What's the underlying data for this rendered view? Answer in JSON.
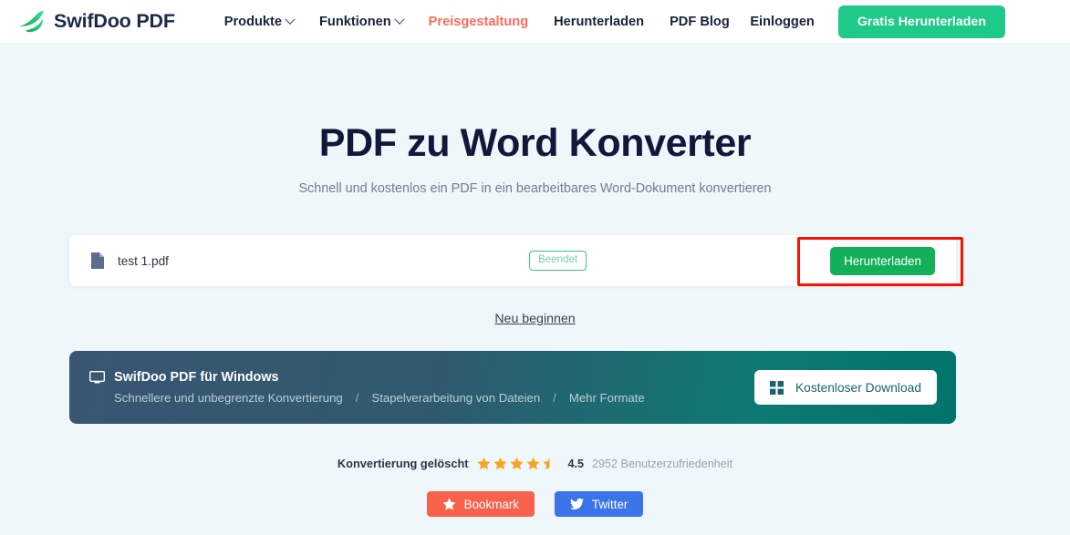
{
  "header": {
    "logo_icon": "swift-bird-logo-icon",
    "logo_text": "SwifDoo PDF",
    "nav": [
      {
        "label": "Produkte",
        "has_dropdown": true,
        "accent": false
      },
      {
        "label": "Funktionen",
        "has_dropdown": true,
        "accent": false
      },
      {
        "label": "Preisgestaltung",
        "has_dropdown": false,
        "accent": true
      },
      {
        "label": "Herunterladen",
        "has_dropdown": false,
        "accent": false
      },
      {
        "label": "PDF Blog",
        "has_dropdown": false,
        "accent": false
      }
    ],
    "login_label": "Einloggen",
    "cta_label": "Gratis Herunterladen",
    "cta_color": "#1ec98a",
    "accent_color": "#ff6b5b"
  },
  "hero": {
    "title": "PDF zu Word Konverter",
    "subtitle": "Schnell und kostenlos ein PDF in ein bearbeitbares Word-Dokument konvertieren"
  },
  "file_card": {
    "file_icon": "document-file-icon",
    "file_name": "test 1.pdf",
    "status_badge": "Beendet",
    "status_color": "#3cc87f",
    "download_label": "Herunterladen",
    "download_color": "#12b058",
    "highlight_color": "#fb1100"
  },
  "restart_link": "Neu beginnen",
  "promo": {
    "monitor_icon": "monitor-icon",
    "title": "SwifDoo PDF für Windows",
    "features": [
      "Schnellere und unbegrenzte Konvertierung",
      "Stapelverarbeitung von Dateien",
      "Mehr Formate"
    ],
    "separator": "/",
    "button_icon": "windows-grid-icon",
    "button_label": "Kostenloser Download",
    "gradient_from": "#3a5572",
    "gradient_to": "#00736b"
  },
  "rating": {
    "label": "Konvertierung gelöscht",
    "score": "4.5",
    "stars_full": 4,
    "stars_half": 1,
    "star_color": "#f5a623",
    "users_text": "2952 Benutzerzufriedenheit"
  },
  "social": [
    {
      "label": "Bookmark",
      "icon": "star-icon",
      "color": "#f9614d"
    },
    {
      "label": "Twitter",
      "icon": "twitter-bird-icon",
      "color": "#3b73e8"
    }
  ]
}
